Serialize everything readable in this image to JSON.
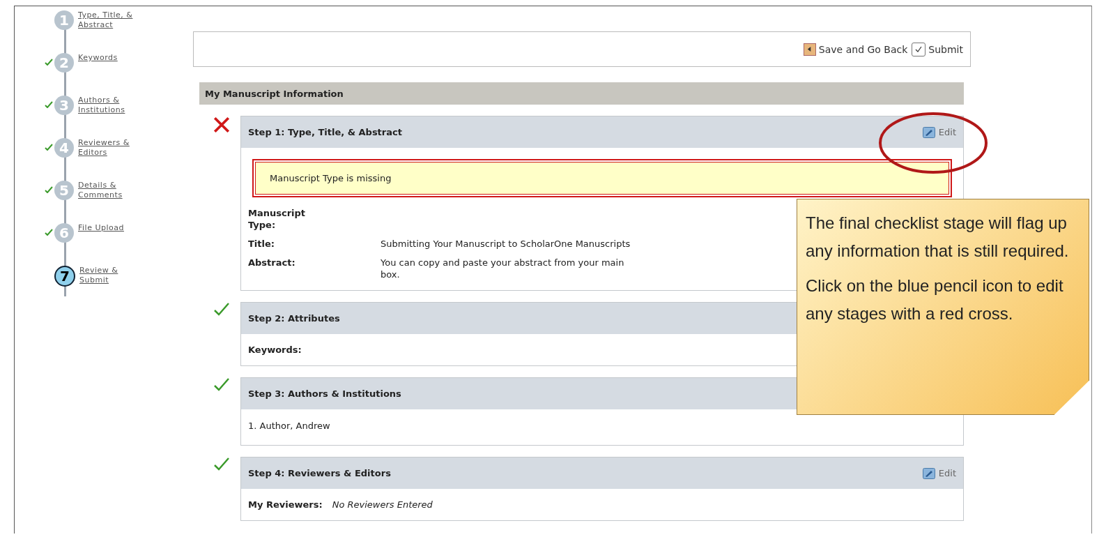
{
  "steps": [
    {
      "number": "1",
      "label": "Type, Title, & Abstract",
      "checked": false,
      "selected": false
    },
    {
      "number": "2",
      "label": "Keywords",
      "checked": true,
      "selected": false
    },
    {
      "number": "3",
      "label": "Authors & Institutions",
      "checked": true,
      "selected": false
    },
    {
      "number": "4",
      "label": "Reviewers & Editors",
      "checked": true,
      "selected": false
    },
    {
      "number": "5",
      "label": "Details & Comments",
      "checked": true,
      "selected": false
    },
    {
      "number": "6",
      "label": "File Upload",
      "checked": true,
      "selected": false
    },
    {
      "number": "7",
      "label": "Review & Submit",
      "checked": false,
      "selected": true
    }
  ],
  "toolbar": {
    "back_button": "Save and Go Back",
    "submit_button": "Submit"
  },
  "panel_title": "My Manuscript Information",
  "sections": [
    {
      "title": "Step 1: Type, Title, & Abstract",
      "kind": "error",
      "edit": "Edit",
      "error": "Manuscript Type is missing",
      "fields": [
        {
          "label": "Manuscript Type:"
        },
        {
          "label": "Title:",
          "lines": [
            "Submitting Your Manuscript to ScholarOne Manuscripts"
          ]
        },
        {
          "label": "Abstract:",
          "lines": [
            "You can copy and paste your abstract from your main",
            "box."
          ]
        }
      ]
    },
    {
      "title": "Step 2: Attributes",
      "kind": "complete",
      "fields": [
        {
          "label": "Keywords:"
        }
      ]
    },
    {
      "title": "Step 3: Authors & Institutions",
      "kind": "complete",
      "list": [
        "1.  Author, Andrew"
      ]
    },
    {
      "title": "Step 4: Reviewers & Editors",
      "kind": "complete",
      "edit": "Edit",
      "fields": [
        {
          "label": "My Reviewers:",
          "note": "No Reviewers Entered"
        }
      ]
    }
  ],
  "callout": {
    "paragraphs": [
      "The final checklist stage will flag up any information that is still required.",
      "Click on the blue pencil icon to edit any stages with a red cross."
    ]
  }
}
